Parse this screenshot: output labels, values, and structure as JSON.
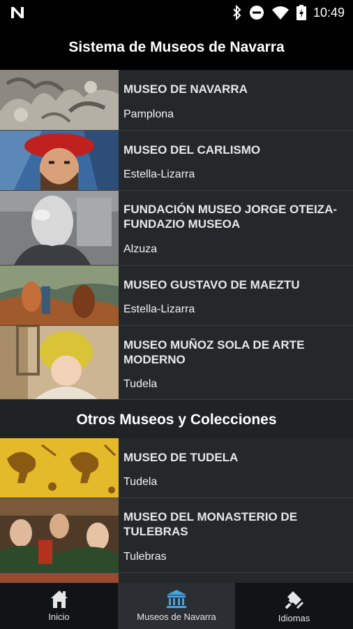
{
  "status": {
    "time": "10:49"
  },
  "appbar": {
    "title": "Sistema de Museos de Navarra"
  },
  "sections": [
    {
      "title": "Sistema de Museos de Navarra",
      "items": [
        {
          "name": "MUSEO DE NAVARRA",
          "place": "Pamplona"
        },
        {
          "name": "MUSEO DEL CARLISMO",
          "place": "Estella-Lizarra"
        },
        {
          "name": "FUNDACIÓN MUSEO JORGE OTEIZA-FUNDAZIO MUSEOA",
          "place": "Alzuza"
        },
        {
          "name": "MUSEO GUSTAVO DE MAEZTU",
          "place": "Estella-Lizarra"
        },
        {
          "name": "MUSEO MUÑOZ SOLA DE ARTE MODERNO",
          "place": "Tudela"
        }
      ]
    },
    {
      "title": "Otros Museos y Colecciones",
      "items": [
        {
          "name": "MUSEO DE TUDELA",
          "place": "Tudela"
        },
        {
          "name": "MUSEO DEL MONASTERIO DE TULEBRAS",
          "place": "Tulebras"
        }
      ]
    }
  ],
  "bottom_nav": [
    {
      "label": "Inicio",
      "icon": "home-icon",
      "active": false
    },
    {
      "label": "Museos de Navarra",
      "icon": "museum-icon",
      "active": true
    },
    {
      "label": "Idiomas",
      "icon": "language-icon",
      "active": false
    }
  ],
  "colors": {
    "accent": "#4aa3df",
    "background": "#1f2326",
    "row": "#24282b"
  }
}
